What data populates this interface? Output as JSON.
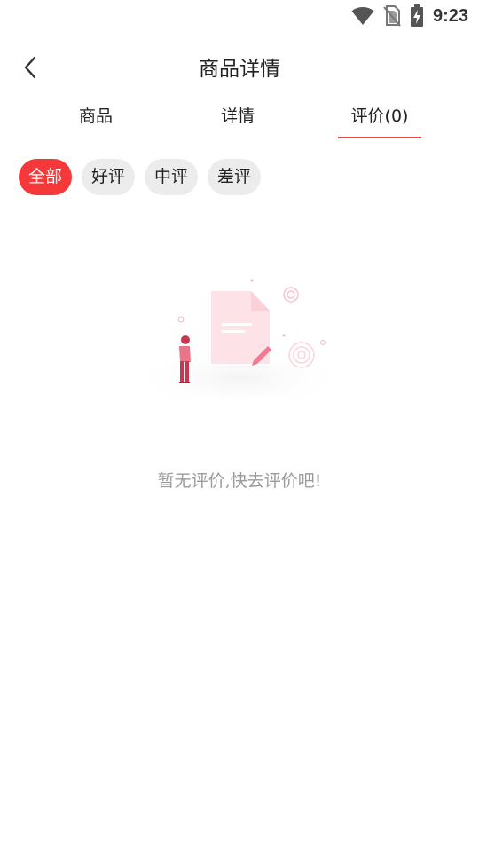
{
  "status_bar": {
    "time": "9:23",
    "icons": [
      "wifi-icon",
      "no-sim-icon",
      "battery-charging-icon"
    ]
  },
  "header": {
    "title": "商品详情",
    "back_icon": "back-arrow-icon"
  },
  "tabs": [
    {
      "label": "商品",
      "active": false
    },
    {
      "label": "详情",
      "active": false
    },
    {
      "label": "评价(0)",
      "active": true
    }
  ],
  "filters": [
    {
      "label": "全部",
      "active": true
    },
    {
      "label": "好评",
      "active": false
    },
    {
      "label": "中评",
      "active": false
    },
    {
      "label": "差评",
      "active": false
    }
  ],
  "empty_state": {
    "illustration": "empty-review-illustration",
    "message": "暂无评价,快去评价吧!"
  },
  "colors": {
    "accent": "#f5393a",
    "indicator": "#e8453c",
    "chip_bg": "#ececec",
    "muted_text": "#9a9a9a"
  }
}
